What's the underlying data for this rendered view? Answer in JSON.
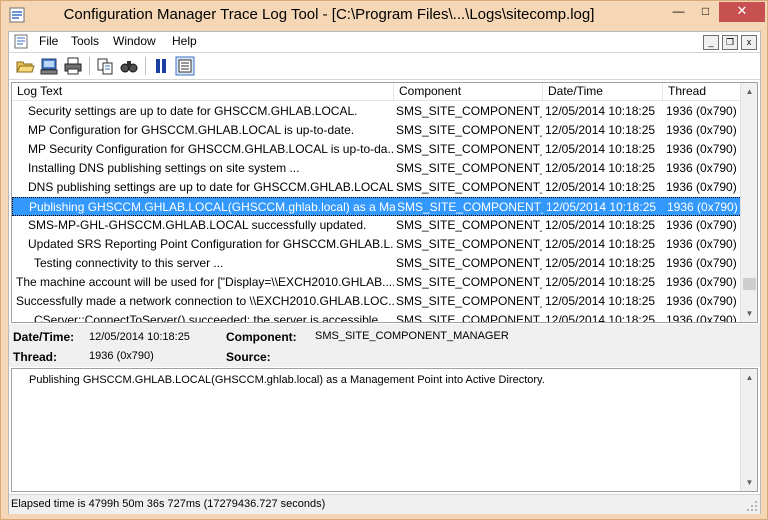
{
  "window": {
    "title": "Configuration Manager Trace Log Tool - [C:\\Program Files\\...\\Logs\\sitecomp.log]",
    "minimize_label": "—",
    "maximize_label": "□",
    "close_label": "✕"
  },
  "menu": {
    "items": [
      "File",
      "Tools",
      "Window",
      "Help"
    ],
    "mdi_minimize": "_",
    "mdi_restore": "❐",
    "mdi_close": "x"
  },
  "toolbar": {
    "buttons": [
      "open-icon",
      "print-setup-icon",
      "print-icon",
      "copy-icon",
      "find-icon",
      "pause-icon",
      "highlight-icon"
    ]
  },
  "log": {
    "columns": [
      "Log Text",
      "Component",
      "Date/Time",
      "Thread"
    ],
    "rows": [
      {
        "text": "Security settings are up to date for GHSCCM.GHLAB.LOCAL.",
        "component": "SMS_SITE_COMPONENT_M",
        "datetime": "12/05/2014 10:18:25",
        "thread": "1936 (0x790)",
        "indent": 1
      },
      {
        "text": "MP Configuration for GHSCCM.GHLAB.LOCAL is up-to-date.",
        "component": "SMS_SITE_COMPONENT_M",
        "datetime": "12/05/2014 10:18:25",
        "thread": "1936 (0x790)",
        "indent": 1
      },
      {
        "text": "MP Security Configuration for GHSCCM.GHLAB.LOCAL is up-to-da...",
        "component": "SMS_SITE_COMPONENT_M",
        "datetime": "12/05/2014 10:18:25",
        "thread": "1936 (0x790)",
        "indent": 1
      },
      {
        "text": "Installing DNS publishing settings on site system ...",
        "component": "SMS_SITE_COMPONENT_M",
        "datetime": "12/05/2014 10:18:25",
        "thread": "1936 (0x790)",
        "indent": 1
      },
      {
        "text": "DNS publishing settings are up to date for GHSCCM.GHLAB.LOCAL.",
        "component": "SMS_SITE_COMPONENT_M",
        "datetime": "12/05/2014 10:18:25",
        "thread": "1936 (0x790)",
        "indent": 1
      },
      {
        "text": "Publishing GHSCCM.GHLAB.LOCAL(GHSCCM.ghlab.local) as a Ma...",
        "component": "SMS_SITE_COMPONENT_M",
        "datetime": "12/05/2014 10:18:25",
        "thread": "1936 (0x790)",
        "indent": 1,
        "selected": true
      },
      {
        "text": "SMS-MP-GHL-GHSCCM.GHLAB.LOCAL successfully updated.",
        "component": "SMS_SITE_COMPONENT_M",
        "datetime": "12/05/2014 10:18:25",
        "thread": "1936 (0x790)",
        "indent": 1
      },
      {
        "text": "Updated SRS Reporting Point Configuration for GHSCCM.GHLAB.L...",
        "component": "SMS_SITE_COMPONENT_M",
        "datetime": "12/05/2014 10:18:25",
        "thread": "1936 (0x790)",
        "indent": 1
      },
      {
        "text": "Testing connectivity to this server ...",
        "component": "SMS_SITE_COMPONENT_M",
        "datetime": "12/05/2014 10:18:25",
        "thread": "1936 (0x790)",
        "indent": 2
      },
      {
        "text": "The machine account will be used for [\"Display=\\\\EXCH2010.GHLAB....",
        "component": "SMS_SITE_COMPONENT_M",
        "datetime": "12/05/2014 10:18:25",
        "thread": "1936 (0x790)",
        "indent": 0
      },
      {
        "text": "Successfully made a network connection to \\\\EXCH2010.GHLAB.LOC...",
        "component": "SMS_SITE_COMPONENT_M",
        "datetime": "12/05/2014 10:18:25",
        "thread": "1936 (0x790)",
        "indent": 0
      },
      {
        "text": "CServer::ConnectToServer() succeeded: the server is accessible.",
        "component": "SMS_SITE_COMPONENT_M",
        "datetime": "12/05/2014 10:18:25",
        "thread": "1936 (0x790)",
        "indent": 2
      }
    ],
    "scroll_position": 0.92
  },
  "details": {
    "datetime_label": "Date/Time:",
    "datetime_value": "12/05/2014 10:18:25",
    "component_label": "Component:",
    "component_value": "SMS_SITE_COMPONENT_MANAGER",
    "thread_label": "Thread:",
    "thread_value": "1936 (0x790)",
    "source_label": "Source:",
    "source_value": ""
  },
  "message": {
    "text": "Publishing GHSCCM.GHLAB.LOCAL(GHSCCM.ghlab.local) as a Management Point into Active Directory."
  },
  "status": {
    "text": "Elapsed time is 4799h 50m 36s 727ms (17279436.727 seconds)"
  },
  "colors": {
    "frame": "#f6d7b5",
    "selection": "#3399ff",
    "close": "#c75050"
  }
}
